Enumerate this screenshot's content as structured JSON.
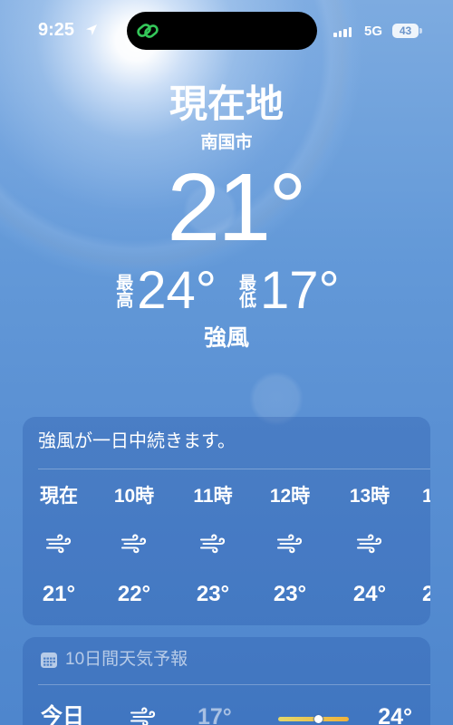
{
  "status_bar": {
    "time": "9:25",
    "network": "5G",
    "battery": "43",
    "location_icon": "location-arrow-icon",
    "island_icon": "link-icon",
    "signal_icon": "signal-icon",
    "battery_icon": "battery-icon"
  },
  "colors": {
    "island_icon": "#34c759",
    "temp_bar_start": "#e4d86a",
    "temp_bar_end": "#f0b23a"
  },
  "current": {
    "location_title": "現在地",
    "city": "南国市",
    "temperature": "21°",
    "high_label": "最高",
    "high": "24°",
    "low_label": "最低",
    "low": "17°",
    "condition": "強風"
  },
  "hourly": {
    "summary": "強風が一日中続きます。",
    "hours": [
      {
        "label": "現在",
        "icon": "wind-icon",
        "temp": "21°"
      },
      {
        "label": "10時",
        "icon": "wind-icon",
        "temp": "22°"
      },
      {
        "label": "11時",
        "icon": "wind-icon",
        "temp": "23°"
      },
      {
        "label": "12時",
        "icon": "wind-icon",
        "temp": "23°"
      },
      {
        "label": "13時",
        "icon": "wind-icon",
        "temp": "24°"
      },
      {
        "label": "1",
        "temp": "2"
      }
    ]
  },
  "daily": {
    "header_icon": "calendar-icon",
    "header": "10日間天気予報",
    "days": [
      {
        "day": "今日",
        "icon": "wind-icon",
        "low": "17°",
        "high": "24°",
        "bar": {
          "low": 17,
          "high": 24,
          "current": 21
        }
      }
    ]
  }
}
